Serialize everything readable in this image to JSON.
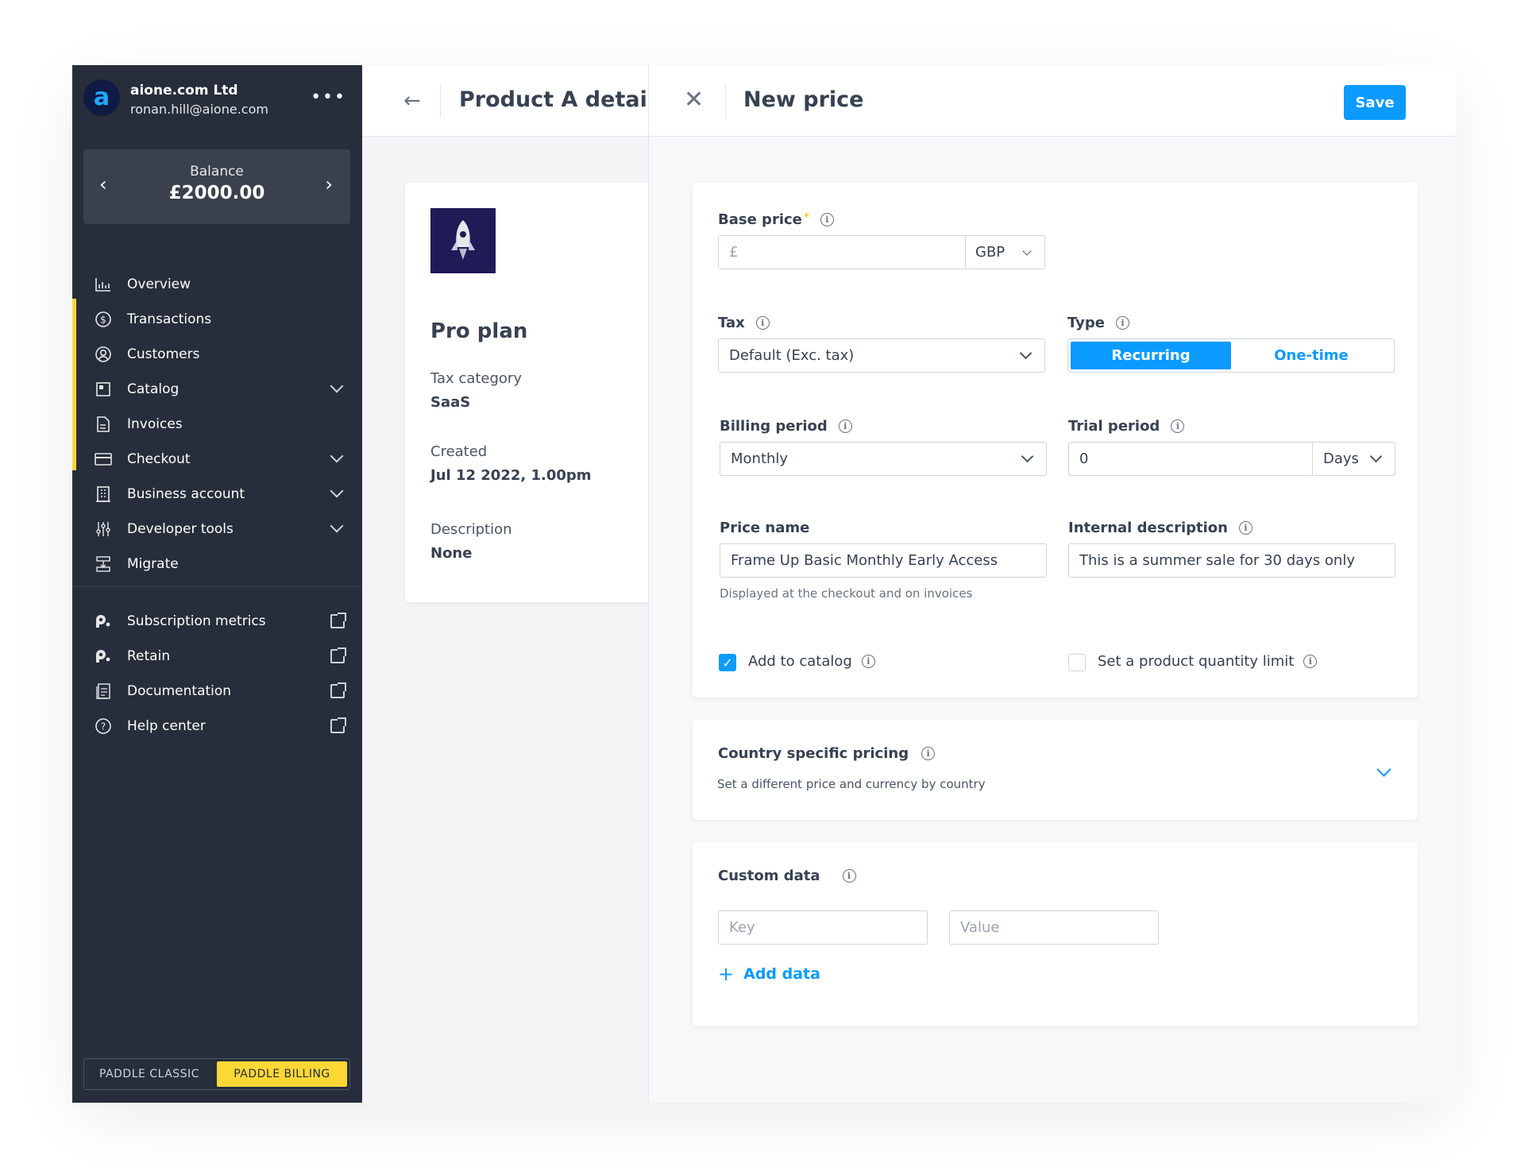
{
  "account": {
    "logo_text": "a",
    "name": "aione.com Ltd",
    "email": "ronan.hill@aione.com",
    "more": "•••"
  },
  "balance": {
    "label": "Balance",
    "value": "£2000.00",
    "prev": "‹",
    "next": "›"
  },
  "nav": {
    "items": [
      {
        "label": "Overview",
        "icon": "chart-icon"
      },
      {
        "label": "Transactions",
        "icon": "dollar-circle-icon"
      },
      {
        "label": "Customers",
        "icon": "user-circle-icon"
      },
      {
        "label": "Catalog",
        "icon": "catalog-icon"
      },
      {
        "label": "Invoices",
        "icon": "document-icon"
      },
      {
        "label": "Checkout",
        "icon": "card-icon"
      },
      {
        "label": "Business account",
        "icon": "building-icon"
      },
      {
        "label": "Developer tools",
        "icon": "sliders-icon"
      },
      {
        "label": "Migrate",
        "icon": "migrate-icon"
      }
    ],
    "external": [
      {
        "label": "Subscription metrics",
        "icon": "profitwell-icon"
      },
      {
        "label": "Retain",
        "icon": "profitwell-icon"
      },
      {
        "label": "Documentation",
        "icon": "docs-icon"
      },
      {
        "label": "Help center",
        "icon": "help-icon"
      }
    ]
  },
  "mode_toggle": {
    "classic": "PADDLE CLASSIC",
    "billing": "PADDLE BILLING",
    "active": "billing"
  },
  "product": {
    "title": "Product A details",
    "plan_name": "Pro plan",
    "tax_category_label": "Tax category",
    "tax_category": "SaaS",
    "created_label": "Created",
    "created": "Jul 12 2022, 1.00pm",
    "description_label": "Description",
    "description": "None"
  },
  "new_price": {
    "title": "New price",
    "save_label": "Save",
    "base_price": {
      "label": "Base price",
      "required": "*",
      "placeholder": "£",
      "currency": "GBP"
    },
    "tax": {
      "label": "Tax",
      "value": "Default (Exc. tax)"
    },
    "type": {
      "label": "Type",
      "options": [
        "Recurring",
        "One-time"
      ],
      "selected": "Recurring"
    },
    "billing_period": {
      "label": "Billing period",
      "value": "Monthly"
    },
    "trial_period": {
      "label": "Trial period",
      "value": "0",
      "unit": "Days"
    },
    "price_name": {
      "label": "Price name",
      "value": "Frame Up Basic Monthly Early Access",
      "help": "Displayed at the checkout and on invoices"
    },
    "internal_description": {
      "label": "Internal description",
      "value": "This is a summer sale for 30 days only"
    },
    "add_to_catalog": {
      "label": "Add to catalog",
      "checked": true
    },
    "quantity_limit": {
      "label": "Set a product quantity limit",
      "checked": false
    },
    "country_pricing": {
      "label": "Country specific pricing",
      "subtitle": "Set a different price and currency by country"
    },
    "custom_data": {
      "label": "Custom data",
      "key_placeholder": "Key",
      "value_placeholder": "Value",
      "add_label": "Add data"
    }
  },
  "colors": {
    "accent": "#0b9bff",
    "sidebar": "#272d3a",
    "highlight": "#fdd835"
  }
}
